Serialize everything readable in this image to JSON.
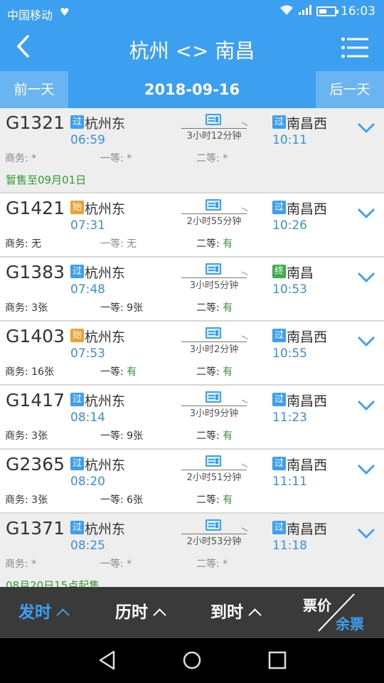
{
  "status_bar": {
    "carrier": "中国移动",
    "time": "16:03"
  },
  "header": {
    "title": "杭州 <> 南昌"
  },
  "date_bar": {
    "prev_label": "前一天",
    "date": "2018-09-16",
    "next_label": "后一天"
  },
  "trains": [
    {
      "number": "G1321",
      "from_type": "过",
      "from_station": "杭州东",
      "depart": "06:59",
      "duration": "3小时12分钟",
      "to_type": "过",
      "to_station": "南昌西",
      "arrive": "10:11",
      "business": "*",
      "first": "*",
      "second": "*",
      "note": "暂售至09月01日"
    },
    {
      "number": "G1421",
      "from_type": "始",
      "from_station": "杭州东",
      "depart": "07:31",
      "duration": "2小时55分钟",
      "to_type": "过",
      "to_station": "南昌西",
      "arrive": "10:26",
      "business": "无",
      "first": "无",
      "second": "有",
      "note": ""
    },
    {
      "number": "G1383",
      "from_type": "过",
      "from_station": "杭州东",
      "depart": "07:48",
      "duration": "3小时5分钟",
      "to_type": "终",
      "to_station": "南昌",
      "arrive": "10:53",
      "business": "3张",
      "first": "9张",
      "second": "有",
      "note": ""
    },
    {
      "number": "G1403",
      "from_type": "始",
      "from_station": "杭州东",
      "depart": "07:53",
      "duration": "3小时2分钟",
      "to_type": "过",
      "to_station": "南昌西",
      "arrive": "10:55",
      "business": "16张",
      "first": "有",
      "second": "有",
      "note": ""
    },
    {
      "number": "G1417",
      "from_type": "过",
      "from_station": "杭州东",
      "depart": "08:14",
      "duration": "3小时9分钟",
      "to_type": "过",
      "to_station": "南昌西",
      "arrive": "11:23",
      "business": "3张",
      "first": "9张",
      "second": "有",
      "note": ""
    },
    {
      "number": "G2365",
      "from_type": "过",
      "from_station": "杭州东",
      "depart": "08:20",
      "duration": "2小时51分钟",
      "to_type": "过",
      "to_station": "南昌西",
      "arrive": "11:11",
      "business": "3张",
      "first": "6张",
      "second": "有",
      "note": ""
    },
    {
      "number": "G1371",
      "from_type": "过",
      "from_station": "杭州东",
      "depart": "08:25",
      "duration": "2小时53分钟",
      "to_type": "过",
      "to_station": "南昌西",
      "arrive": "11:18",
      "business": "*",
      "first": "*",
      "second": "*",
      "note": "08月20日15点起售"
    }
  ],
  "seat_labels": {
    "business": "商务: ",
    "first": "一等: ",
    "second": "二等: "
  },
  "sort_bar": {
    "depart": "发时",
    "duration": "历时",
    "arrive": "到时",
    "price": "票价",
    "remaining": "余票"
  },
  "colors": {
    "primary": "#3d9ff0",
    "available": "#2e9a2e",
    "start_badge": "#f0a030",
    "end_badge": "#3bb04a"
  }
}
